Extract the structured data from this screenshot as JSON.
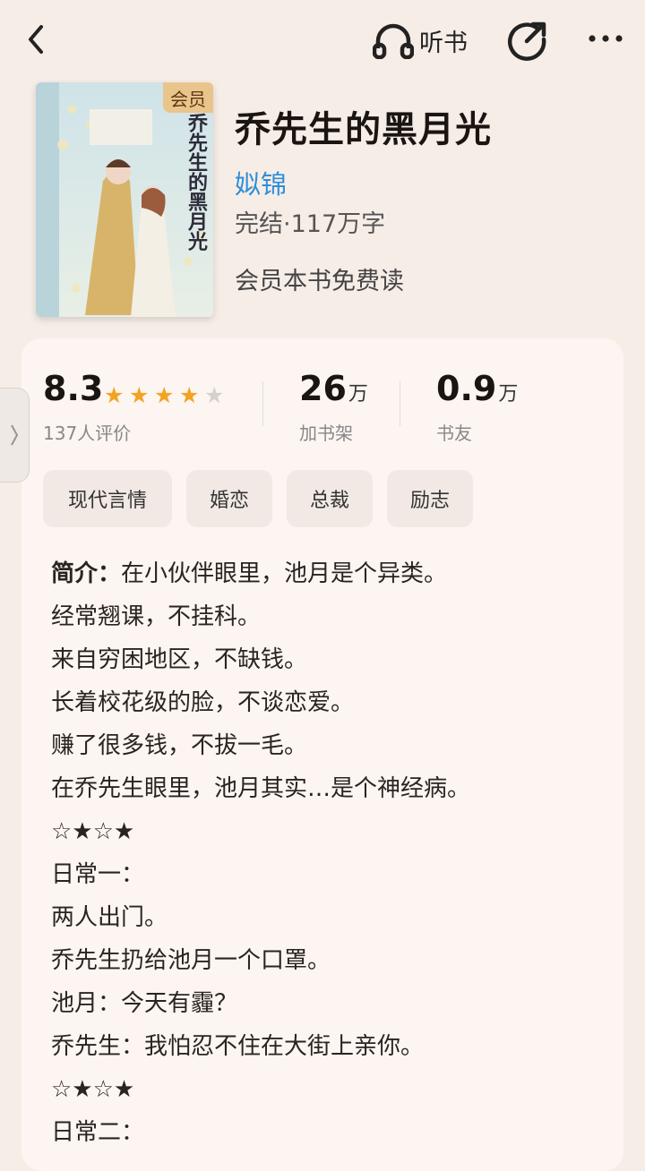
{
  "topbar": {
    "listen_label": "听书",
    "icons": [
      "back-icon",
      "headphones-icon",
      "share-icon",
      "more-icon"
    ]
  },
  "book": {
    "badge": "会员",
    "title": "乔先生的黑月光",
    "author": "姒锦",
    "status": "完结·117万字",
    "vip_note": "会员本书免费读",
    "cover_text": "乔先生的黑月光"
  },
  "stats": {
    "score": "8.3",
    "stars_filled": 4,
    "stars_total": 5,
    "rating_count": "137人评价",
    "bookshelf_num": "26",
    "bookshelf_unit": "万",
    "bookshelf_label": "加书架",
    "friends_num": "0.9",
    "friends_unit": "万",
    "friends_label": "书友"
  },
  "tags": [
    "现代言情",
    "婚恋",
    "总裁",
    "励志"
  ],
  "intro": {
    "label": "简介：",
    "lines": [
      "在小伙伴眼里，池月是个异类。",
      "经常翘课，不挂科。",
      "来自穷困地区，不缺钱。",
      "长着校花级的脸，不谈恋爱。",
      "赚了很多钱，不拔一毛。",
      "在乔先生眼里，池月其实…是个神经病。",
      "☆★☆★",
      "日常一：",
      "两人出门。",
      "乔先生扔给池月一个口罩。",
      "池月：今天有霾？",
      "乔先生：我怕忍不住在大街上亲你。",
      "☆★☆★",
      "日常二："
    ]
  },
  "colors": {
    "background": "#f7ede7",
    "card": "#fcf5f2",
    "author": "#2f8fd8",
    "star": "#f2a322",
    "badge": "#e9c58c"
  }
}
